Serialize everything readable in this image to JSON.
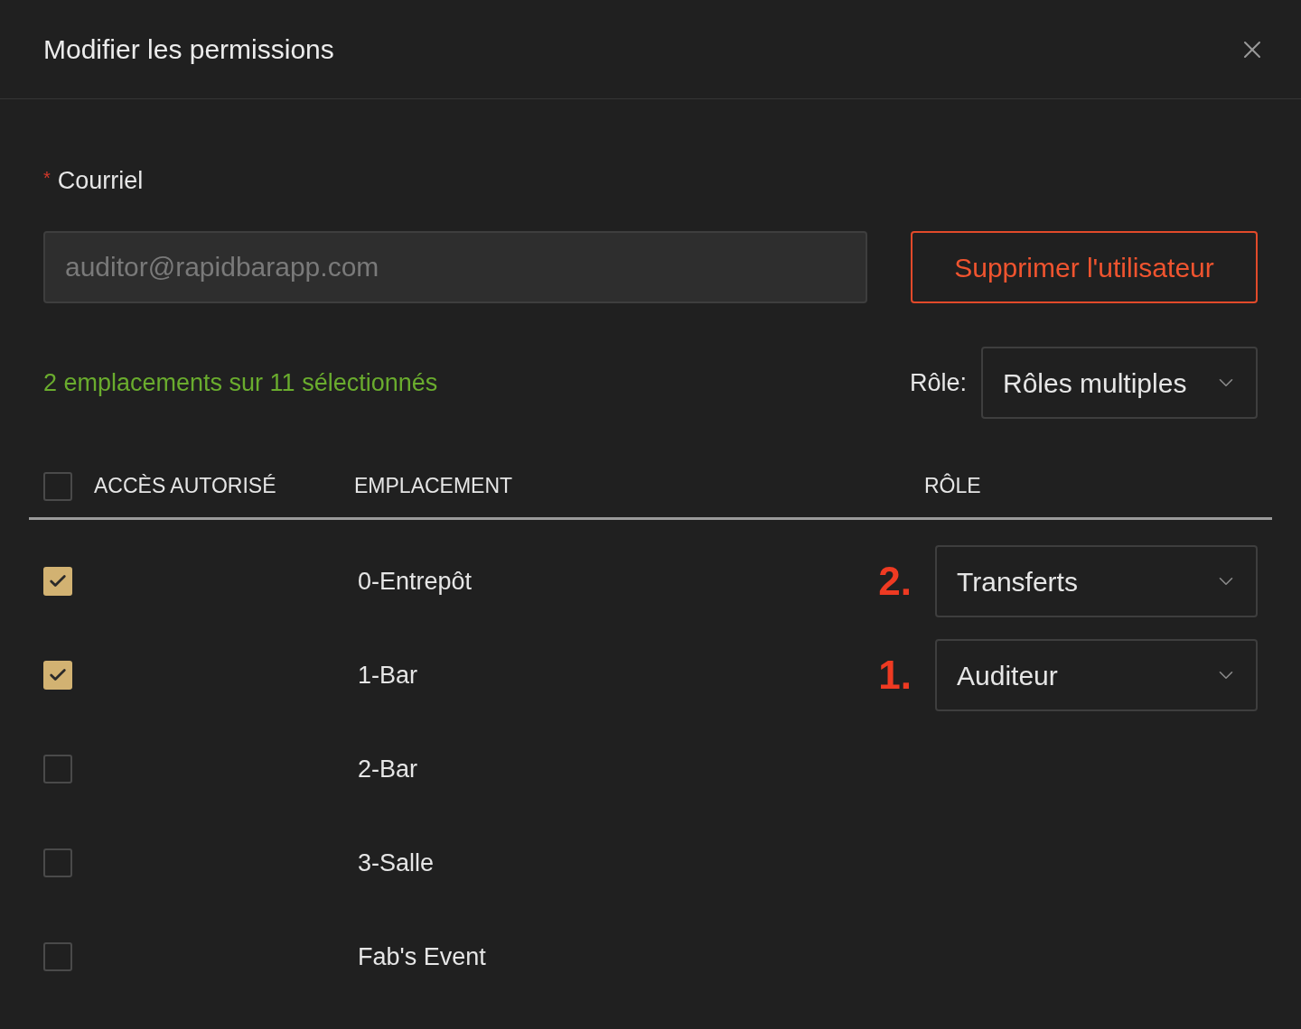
{
  "dialog": {
    "title": "Modifier les permissions"
  },
  "email": {
    "label": "Courriel",
    "required_mark": "*",
    "value": "auditor@rapidbarapp.com",
    "disabled": true
  },
  "delete_button": "Supprimer l'utilisateur",
  "selection_summary": "2 emplacements sur 11 sélectionnés",
  "role_filter": {
    "label": "Rôle:",
    "value": "Rôles multiples"
  },
  "table": {
    "select_all_checked": false,
    "columns": [
      "ACCÈS AUTORISÉ",
      "EMPLACEMENT",
      "RÔLE"
    ],
    "rows": [
      {
        "checked": true,
        "location": "0-Entrepôt",
        "annotation": "2.",
        "role": "Transferts"
      },
      {
        "checked": true,
        "location": "1-Bar",
        "annotation": "1.",
        "role": "Auditeur"
      },
      {
        "checked": false,
        "location": "2-Bar"
      },
      {
        "checked": false,
        "location": "3-Salle"
      },
      {
        "checked": false,
        "location": "Fab's Event"
      }
    ]
  }
}
